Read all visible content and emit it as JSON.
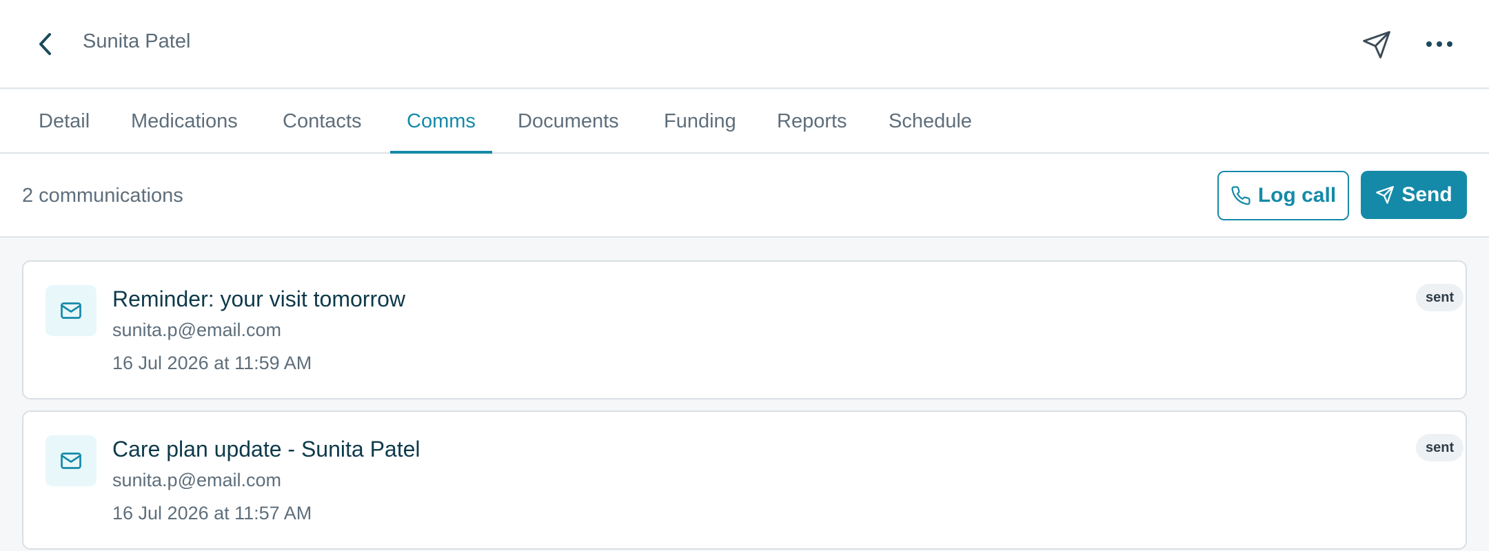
{
  "header": {
    "title": "Sunita Patel",
    "back_icon": "chevron-left-icon",
    "send_icon": "paper-plane-icon",
    "more_icon": "more-horizontal-icon"
  },
  "tabs": [
    {
      "label": "Detail",
      "active": false
    },
    {
      "label": "Medications",
      "active": false
    },
    {
      "label": "Contacts",
      "active": false
    },
    {
      "label": "Comms",
      "active": true
    },
    {
      "label": "Documents",
      "active": false
    },
    {
      "label": "Funding",
      "active": false
    },
    {
      "label": "Reports",
      "active": false
    },
    {
      "label": "Schedule",
      "active": false
    }
  ],
  "toolbar": {
    "count_label": "2 communications",
    "log_call_label": "Log call",
    "send_label": "Send"
  },
  "communications": [
    {
      "subject": "Reminder: your visit tomorrow",
      "recipient": "sunita.p@email.com",
      "timestamp": "16 Jul 2026 at 11:59 AM",
      "status": "sent"
    },
    {
      "subject": "Care plan update - Sunita Patel",
      "recipient": "sunita.p@email.com",
      "timestamp": "16 Jul 2026 at 11:57 AM",
      "status": "sent"
    }
  ],
  "colors": {
    "accent": "#148aa8",
    "text_dark": "#0e3a4a",
    "text_muted": "#5e6e7b",
    "border": "#dfe4e8"
  }
}
